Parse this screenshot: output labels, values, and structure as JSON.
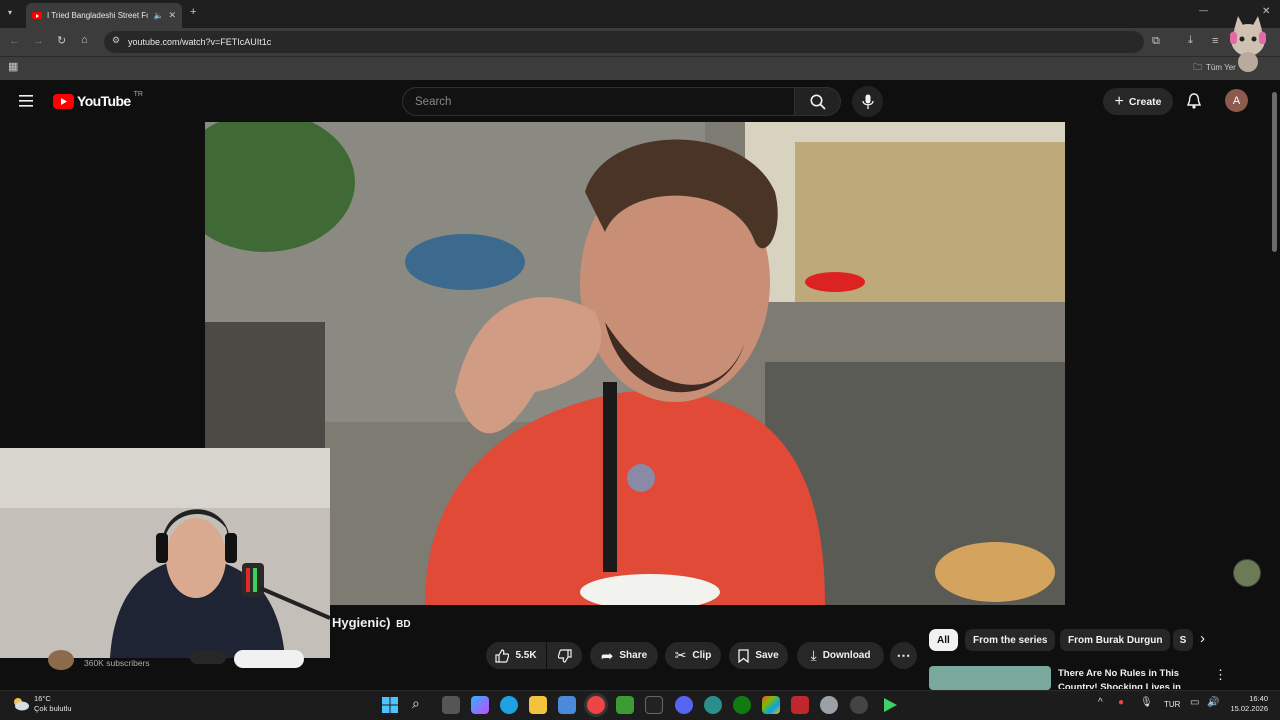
{
  "browser": {
    "tab_title": "I Tried Bangladeshi Street Fo",
    "url": "youtube.com/watch?v=FETIcAUIt1c",
    "bookmark_folder": "Tüm Yer"
  },
  "youtube": {
    "logo_text": "YouTube",
    "country_code": "TR",
    "search_placeholder": "Search",
    "create_label": "Create",
    "avatar_letter": "A"
  },
  "video": {
    "title_visible": "Hygienic)",
    "title_flag": "BD",
    "channel_subscribers": "360K subscribers",
    "likes": "5.5K",
    "actions": {
      "share": "Share",
      "clip": "Clip",
      "save": "Save",
      "download": "Download"
    }
  },
  "sidebar": {
    "chips": [
      "All",
      "From the series",
      "From Burak Durgun",
      "S"
    ],
    "recommendation_title": "There Are No Rules in This Country! Shocking Lives in"
  },
  "taskbar": {
    "weather_temp": "16°C",
    "weather_desc": "Çok bulutlu",
    "language": "TUR",
    "time": "16:40",
    "date": "15.02.2026"
  },
  "colors": {
    "brand_red": "#ff0000",
    "page_bg": "#0f0f0f",
    "pill_bg": "#272727"
  }
}
